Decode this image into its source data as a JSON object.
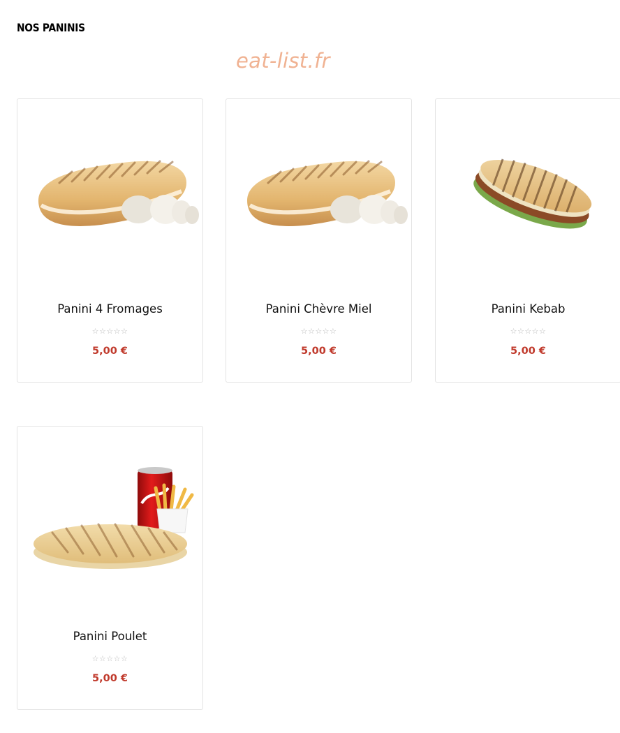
{
  "section": {
    "title": "NOS PANINIS"
  },
  "watermark": "eat-list.fr",
  "products": [
    {
      "name": "Panini 4 Fromages",
      "rating_stars": "☆☆☆☆☆",
      "rating": 0,
      "price": "5,00 €",
      "image": "panini-cheese"
    },
    {
      "name": "Panini Chèvre Miel",
      "rating_stars": "☆☆☆☆☆",
      "rating": 0,
      "price": "5,00 €",
      "image": "panini-cheese"
    },
    {
      "name": "Panini Kebab",
      "rating_stars": "☆☆☆☆☆",
      "rating": 0,
      "price": "5,00 €",
      "image": "panini-kebab"
    },
    {
      "name": "Panini Poulet",
      "rating_stars": "☆☆☆☆☆",
      "rating": 0,
      "price": "5,00 €",
      "image": "panini-menu"
    }
  ],
  "colors": {
    "price": "#c0392b",
    "border": "#e3e3e3",
    "watermark": "#f0b292"
  }
}
